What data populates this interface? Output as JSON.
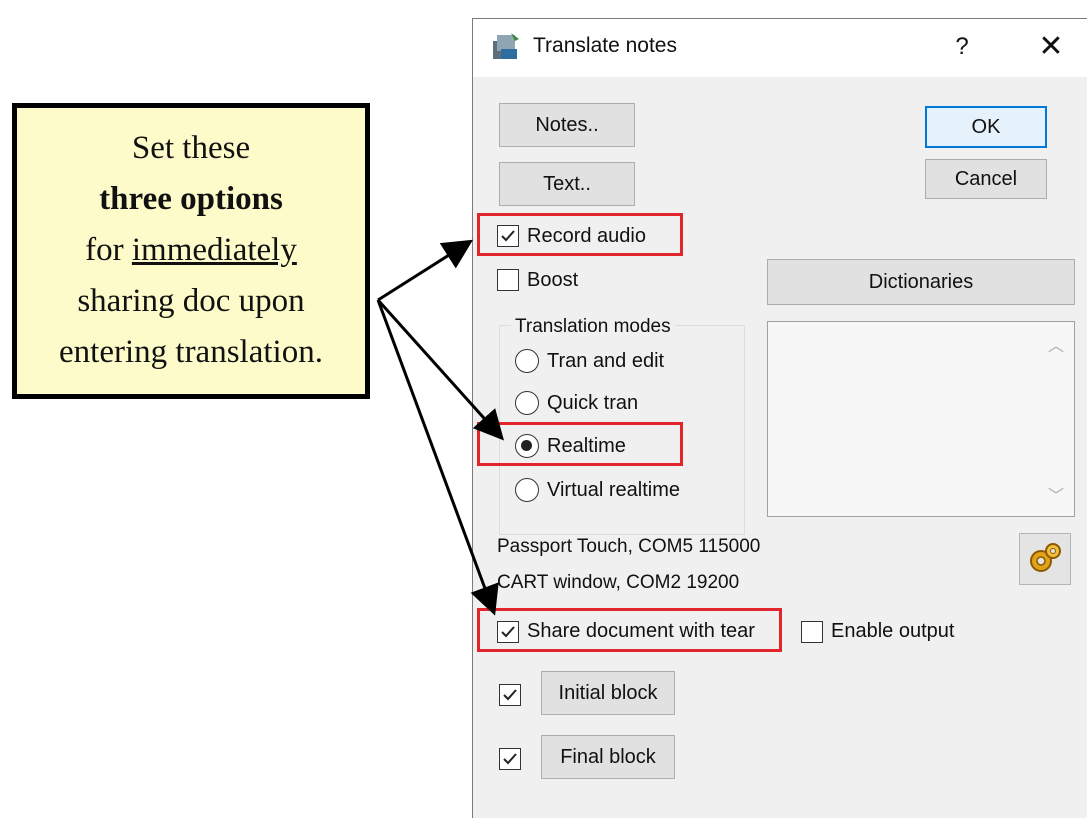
{
  "callout": {
    "line1": "Set these",
    "line2": "three options",
    "line3_pre": "for ",
    "line3_u": "immediately",
    "line4": "sharing doc upon",
    "line5": "entering translation."
  },
  "dialog": {
    "title": "Translate notes",
    "help": "?",
    "close": "✕",
    "buttons": {
      "notes": "Notes..",
      "text": "Text..",
      "ok": "OK",
      "cancel": "Cancel",
      "dictionaries": "Dictionaries",
      "initial_block": "Initial block",
      "final_block": "Final block"
    },
    "checkboxes": {
      "record_audio": {
        "label": "Record audio",
        "checked": true
      },
      "boost": {
        "label": "Boost",
        "checked": false
      },
      "share_document": {
        "label": "Share document with tear",
        "checked": true
      },
      "enable_output": {
        "label": "Enable output",
        "checked": false
      },
      "initial_block": {
        "checked": true
      },
      "final_block": {
        "checked": true
      }
    },
    "translation_modes": {
      "title": "Translation modes",
      "options": [
        "Tran and edit",
        "Quick tran",
        "Realtime",
        "Virtual realtime"
      ],
      "selected": "Realtime"
    },
    "info": {
      "line1": "Passport Touch, COM5 115000",
      "line2": "CART window, COM2 19200"
    }
  },
  "colors": {
    "highlight": "#e0262c",
    "callout_bg": "#fdfbc9",
    "dialog_bg": "#f0f0f0",
    "default_button_border": "#0078d7"
  }
}
